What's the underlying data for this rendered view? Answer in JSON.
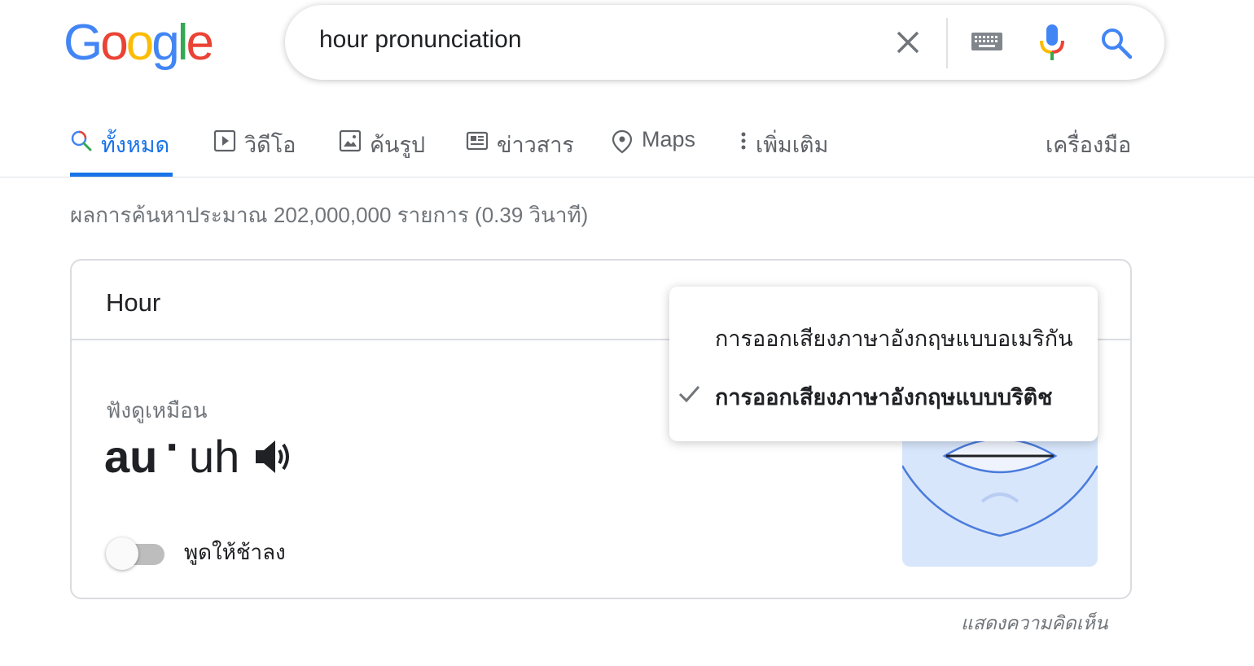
{
  "logo": {
    "letters": [
      "G",
      "o",
      "o",
      "g",
      "l",
      "e"
    ],
    "colors": [
      "#4285F4",
      "#EA4335",
      "#FBBC05",
      "#4285F4",
      "#34A853",
      "#EA4335"
    ]
  },
  "search": {
    "query": "hour pronunciation"
  },
  "icons": {
    "clear": "close-icon",
    "keyboard": "keyboard-icon",
    "mic": "mic-icon",
    "search": "search-icon"
  },
  "tabs": [
    {
      "label": "ทั้งหมด",
      "icon": "search-icon",
      "active": true
    },
    {
      "label": "วิดีโอ",
      "icon": "play-icon"
    },
    {
      "label": "ค้นรูป",
      "icon": "image-icon"
    },
    {
      "label": "ข่าวสาร",
      "icon": "news-icon"
    },
    {
      "label": "Maps",
      "icon": "map-pin-icon"
    },
    {
      "label": "เพิ่มเติม",
      "icon": "more-vertical-icon"
    }
  ],
  "tools_label": "เครื่องมือ",
  "stats": "ผลการค้นหาประมาณ 202,000,000 รายการ (0.39 วินาที)",
  "card": {
    "title": "Hour",
    "sounds_like": "ฟังดูเหมือน",
    "phonetic": {
      "part1": "au",
      "separator": "·",
      "part2": "uh"
    },
    "slow_label": "พูดให้ช้าลง",
    "slow_enabled": false
  },
  "menu": {
    "options": [
      "การออกเสียงภาษาอังกฤษแบบอเมริกัน",
      "การออกเสียงภาษาอังกฤษแบบบริติช"
    ],
    "selected_index": 1
  },
  "feedback": "แสดงความคิดเห็น",
  "colors": {
    "accent": "#1a73e8",
    "text": "#202124",
    "secondary": "#70757a",
    "mouth_bg": "#d8e6fb"
  }
}
